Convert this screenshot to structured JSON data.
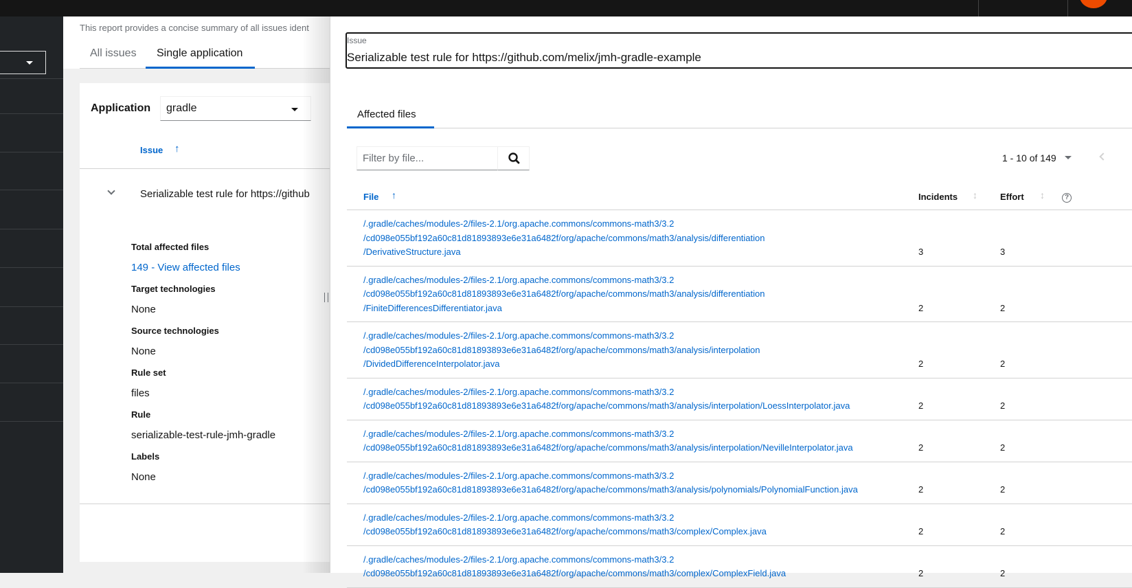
{
  "colors": {
    "accent": "#0066cc",
    "topbar": "#151515",
    "sidebar": "#212427",
    "avatar": "#ee4b00"
  },
  "main": {
    "description": "This report provides a concise summary of all issues ident",
    "tabs": [
      {
        "label": "All issues"
      },
      {
        "label": "Single application",
        "active": true
      }
    ],
    "application_label": "Application",
    "application_value": "gradle",
    "issue_column": "Issue",
    "issue_row": "Serializable test rule for https://github",
    "details": [
      {
        "label": "Total affected files",
        "value": "149 - View affected files",
        "link": true
      },
      {
        "label": "Target technologies",
        "value": "None"
      },
      {
        "label": "Source technologies",
        "value": "None"
      },
      {
        "label": "Rule set",
        "value": "files"
      },
      {
        "label": "Rule",
        "value": "serializable-test-rule-jmh-gradle"
      },
      {
        "label": "Labels",
        "value": "None"
      }
    ]
  },
  "drawer": {
    "issue_label": "Issue",
    "issue_value": "Serializable test rule for https://github.com/melix/jmh-gradle-example",
    "tab": "Affected files",
    "filter_placeholder": "Filter by file...",
    "pagination": {
      "range": "1 - 10",
      "of": "of",
      "total": "149"
    },
    "columns": {
      "file": "File",
      "incidents": "Incidents",
      "effort": "Effort"
    },
    "rows": [
      {
        "lines": [
          "/.gradle/caches/modules-2/files-2.1/org.apache.commons/commons-math3/3.2",
          "/cd098e055bf192a60c81d81893893e6e31a6482f/org/apache/commons/math3/analysis/differentiation",
          "/DerivativeStructure.java"
        ],
        "incidents": "3",
        "effort": "3"
      },
      {
        "lines": [
          "/.gradle/caches/modules-2/files-2.1/org.apache.commons/commons-math3/3.2",
          "/cd098e055bf192a60c81d81893893e6e31a6482f/org/apache/commons/math3/analysis/differentiation",
          "/FiniteDifferencesDifferentiator.java"
        ],
        "incidents": "2",
        "effort": "2"
      },
      {
        "lines": [
          "/.gradle/caches/modules-2/files-2.1/org.apache.commons/commons-math3/3.2",
          "/cd098e055bf192a60c81d81893893e6e31a6482f/org/apache/commons/math3/analysis/interpolation",
          "/DividedDifferenceInterpolator.java"
        ],
        "incidents": "2",
        "effort": "2"
      },
      {
        "lines": [
          "/.gradle/caches/modules-2/files-2.1/org.apache.commons/commons-math3/3.2",
          "/cd098e055bf192a60c81d81893893e6e31a6482f/org/apache/commons/math3/analysis/interpolation/LoessInterpolator.java"
        ],
        "incidents": "2",
        "effort": "2"
      },
      {
        "lines": [
          "/.gradle/caches/modules-2/files-2.1/org.apache.commons/commons-math3/3.2",
          "/cd098e055bf192a60c81d81893893e6e31a6482f/org/apache/commons/math3/analysis/interpolation/NevilleInterpolator.java"
        ],
        "incidents": "2",
        "effort": "2"
      },
      {
        "lines": [
          "/.gradle/caches/modules-2/files-2.1/org.apache.commons/commons-math3/3.2",
          "/cd098e055bf192a60c81d81893893e6e31a6482f/org/apache/commons/math3/analysis/polynomials/PolynomialFunction.java"
        ],
        "incidents": "2",
        "effort": "2"
      },
      {
        "lines": [
          "/.gradle/caches/modules-2/files-2.1/org.apache.commons/commons-math3/3.2",
          "/cd098e055bf192a60c81d81893893e6e31a6482f/org/apache/commons/math3/complex/Complex.java"
        ],
        "incidents": "2",
        "effort": "2"
      },
      {
        "lines": [
          "/.gradle/caches/modules-2/files-2.1/org.apache.commons/commons-math3/3.2",
          "/cd098e055bf192a60c81d81893893e6e31a6482f/org/apache/commons/math3/complex/ComplexField.java"
        ],
        "incidents": "2",
        "effort": "2"
      }
    ]
  }
}
